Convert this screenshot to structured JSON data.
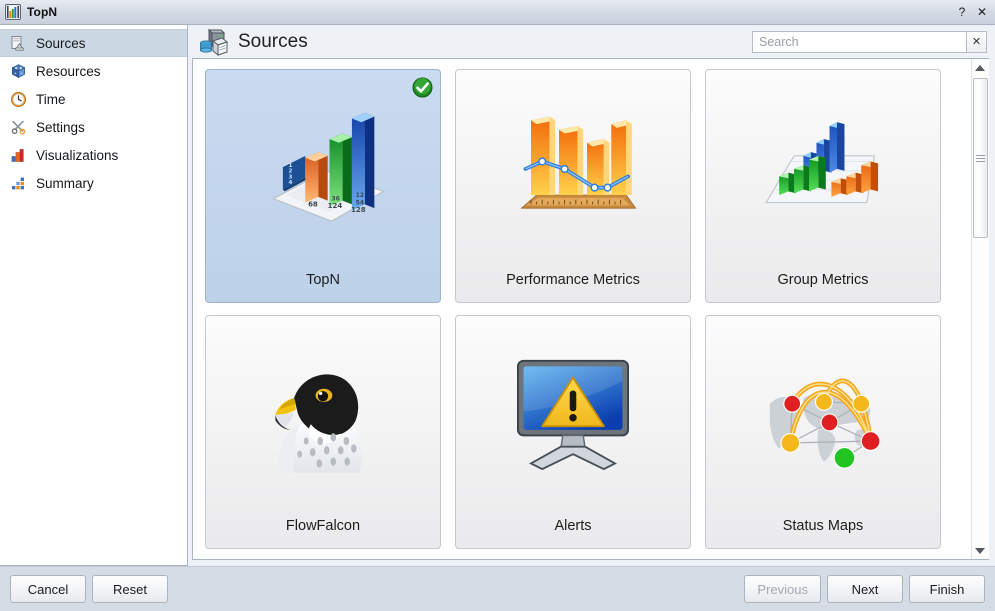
{
  "window": {
    "title": "TopN",
    "icon": "bar-chart-icon",
    "help_label": "?",
    "close_label": "✕"
  },
  "sidebar": {
    "items": [
      {
        "label": "Sources",
        "icon": "sources-icon",
        "selected": true
      },
      {
        "label": "Resources",
        "icon": "resources-icon",
        "selected": false
      },
      {
        "label": "Time",
        "icon": "clock-icon",
        "selected": false
      },
      {
        "label": "Settings",
        "icon": "scissors-icon",
        "selected": false
      },
      {
        "label": "Visualizations",
        "icon": "bar-chart-icon",
        "selected": false
      },
      {
        "label": "Summary",
        "icon": "summary-blocks-icon",
        "selected": false
      }
    ]
  },
  "header": {
    "title": "Sources",
    "icon": "sources-header-icon"
  },
  "search": {
    "value": "",
    "placeholder": "Search",
    "clear_label": "✕"
  },
  "main": {
    "tiles": [
      {
        "label": "TopN",
        "icon": "topn-chart-icon",
        "selected": true
      },
      {
        "label": "Performance Metrics",
        "icon": "performance-metrics-icon",
        "selected": false
      },
      {
        "label": "Group Metrics",
        "icon": "group-metrics-icon",
        "selected": false
      },
      {
        "label": "FlowFalcon",
        "icon": "falcon-icon",
        "selected": false
      },
      {
        "label": "Alerts",
        "icon": "alert-monitor-icon",
        "selected": false
      },
      {
        "label": "Status Maps",
        "icon": "status-map-icon",
        "selected": false
      }
    ]
  },
  "scrollbar": {
    "up_label": "▲",
    "down_label": "▼"
  },
  "footer": {
    "cancel_label": "Cancel",
    "reset_label": "Reset",
    "previous_label": "Previous",
    "previous_disabled": true,
    "next_label": "Next",
    "finish_label": "Finish"
  },
  "colors": {
    "selection_blue": "#c2d5ec",
    "check_green": "#2f9e2f",
    "window_bg": "#d6dce6",
    "panel_bg": "#eef1f5"
  }
}
